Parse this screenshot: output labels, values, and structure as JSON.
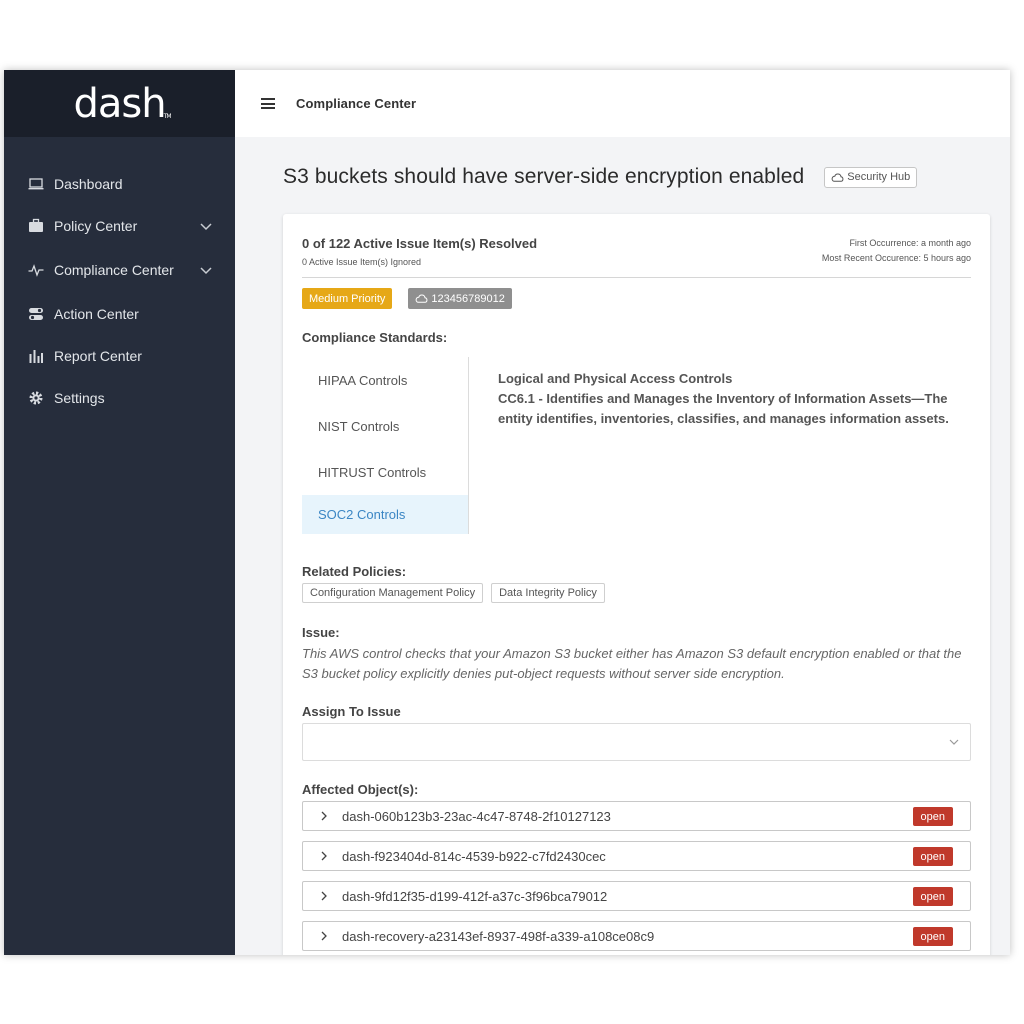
{
  "app": {
    "logo": "dash",
    "logo_tm": "TM"
  },
  "sidebar": {
    "items": [
      {
        "label": "Dashboard",
        "icon": "laptop-icon"
      },
      {
        "label": "Policy Center",
        "icon": "briefcase-icon",
        "expandable": true
      },
      {
        "label": "Compliance Center",
        "icon": "pulse-icon",
        "expandable": true
      },
      {
        "label": "Action Center",
        "icon": "toggles-icon"
      },
      {
        "label": "Report Center",
        "icon": "bar-chart-icon"
      },
      {
        "label": "Settings",
        "icon": "gear-icon"
      }
    ]
  },
  "header": {
    "title": "Compliance Center"
  },
  "page": {
    "title": "S3 buckets should have server-side encryption enabled",
    "source_badge": "Security Hub"
  },
  "summary": {
    "resolved": "0 of 122 Active Issue Item(s) Resolved",
    "ignored": "0 Active Issue Item(s) Ignored",
    "first_occurrence": "First Occurrence: a month ago",
    "recent_occurrence": "Most Recent Occurence: 5 hours ago"
  },
  "tags": {
    "priority": "Medium Priority",
    "account": "123456789012"
  },
  "colors": {
    "priority": "#e6a817",
    "open": "#c0392b",
    "active_tab": "#3b86c4",
    "sidebar": "#262d3c"
  },
  "compliance": {
    "label": "Compliance Standards:",
    "tabs": [
      "HIPAA Controls",
      "NIST Controls",
      "HITRUST Controls",
      "SOC2 Controls"
    ],
    "active_tab": "SOC2 Controls",
    "detail_title": "Logical and Physical Access Controls",
    "detail_body": "CC6.1 - Identifies and Manages the Inventory of Information Assets—The entity identifies, inventories, classifies, and manages information assets."
  },
  "related": {
    "label": "Related Policies:",
    "policies": [
      "Configuration Management Policy",
      "Data Integrity Policy"
    ]
  },
  "issue": {
    "label": "Issue:",
    "text": "This AWS control checks that your Amazon S3 bucket either has Amazon S3 default encryption enabled or that the S3 bucket policy explicitly denies put-object requests without server side encryption."
  },
  "assign": {
    "label": "Assign To Issue",
    "value": ""
  },
  "affected": {
    "label": "Affected Object(s):",
    "items": [
      {
        "id": "dash-060b123b3-23ac-4c47-8748-2f10127123",
        "status": "open"
      },
      {
        "id": "dash-f923404d-814c-4539-b922-c7fd2430cec",
        "status": "open"
      },
      {
        "id": "dash-9fd12f35-d199-412f-a37c-3f96bca79012",
        "status": "open"
      },
      {
        "id": "dash-recovery-a23143ef-8937-498f-a339-a108ce08c9",
        "status": "open"
      }
    ]
  }
}
